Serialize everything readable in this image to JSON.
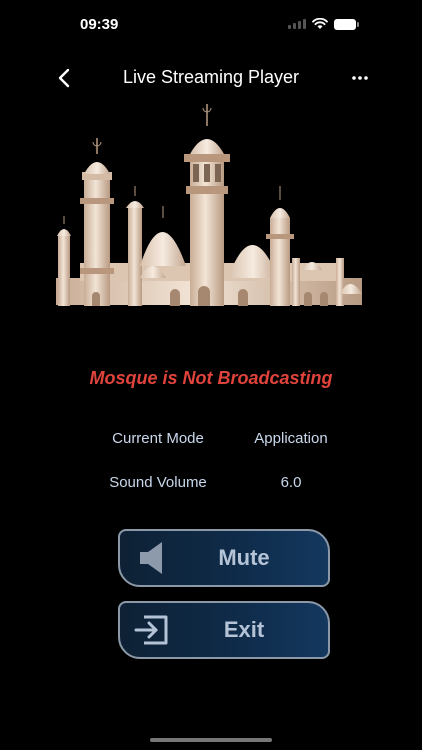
{
  "status_bar": {
    "time": "09:39"
  },
  "nav": {
    "title": "Live Streaming Player",
    "back_icon": "chevron-left-icon",
    "more_icon": "ellipsis-icon"
  },
  "broadcast": {
    "status": "Mosque is Not Broadcasting",
    "status_color": "#e0433c"
  },
  "info": {
    "mode_label": "Current Mode",
    "mode_value": "Application",
    "volume_label": "Sound Volume",
    "volume_value": "6.0"
  },
  "buttons": {
    "mute_label": "Mute",
    "mute_icon": "speaker-icon",
    "exit_label": "Exit",
    "exit_icon": "exit-icon"
  },
  "colors": {
    "background": "#000000",
    "accent": "#14385f",
    "info_text": "#c9d8ec"
  }
}
